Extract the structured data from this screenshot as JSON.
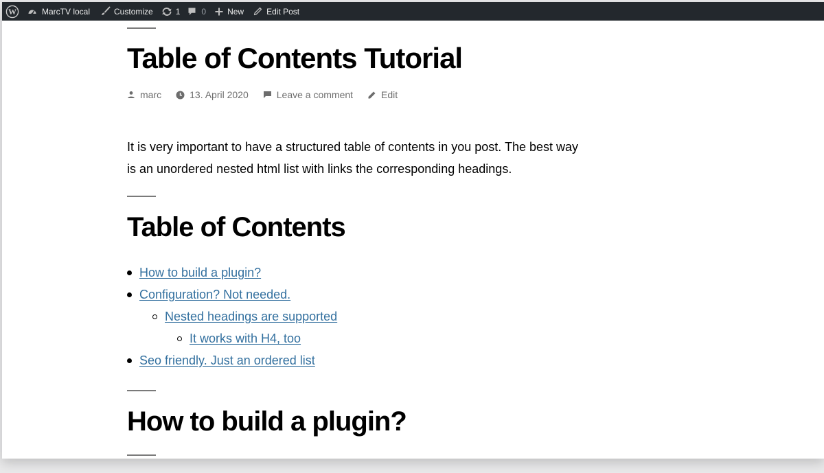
{
  "admin_bar": {
    "site_name": "MarcTV local",
    "customize_label": "Customize",
    "updates_count": "1",
    "comments_count": "0",
    "new_label": "New",
    "edit_post_label": "Edit Post"
  },
  "post": {
    "title": "Table of Contents Tutorial",
    "meta": {
      "author": "marc",
      "date": "13. April 2020",
      "comment_link": "Leave a comment",
      "edit_link": "Edit"
    },
    "intro": "It is very important to have a structured table of contents in you post. The best way is an unordered nested html list with links the corresponding headings."
  },
  "toc_section": {
    "heading": "Table of Contents",
    "items": [
      {
        "label": "How to build a plugin?",
        "level": 1
      },
      {
        "label": "Configuration? Not needed.",
        "level": 1
      },
      {
        "label": "Nested headings are supported",
        "level": 2
      },
      {
        "label": "It works with H4, too",
        "level": 3
      },
      {
        "label": "Seo friendly. Just an ordered list",
        "level": 1
      }
    ]
  },
  "next_section": {
    "heading": "How to build a plugin?"
  },
  "colors": {
    "admin_bar_bg": "#23282d",
    "link": "#33709f",
    "meta_text": "#6d6d6d",
    "body_text": "#000000"
  },
  "icons": {
    "wp_logo": "wordpress-logo-icon",
    "site": "dashboard-icon",
    "customize": "paintbrush-icon",
    "updates": "update-icon",
    "comments": "comment-bubble-icon",
    "new": "plus-icon",
    "edit": "pencil-icon",
    "author": "person-icon",
    "date": "clock-icon",
    "comment": "comment-icon",
    "edit_meta": "edit-pencil-icon"
  }
}
